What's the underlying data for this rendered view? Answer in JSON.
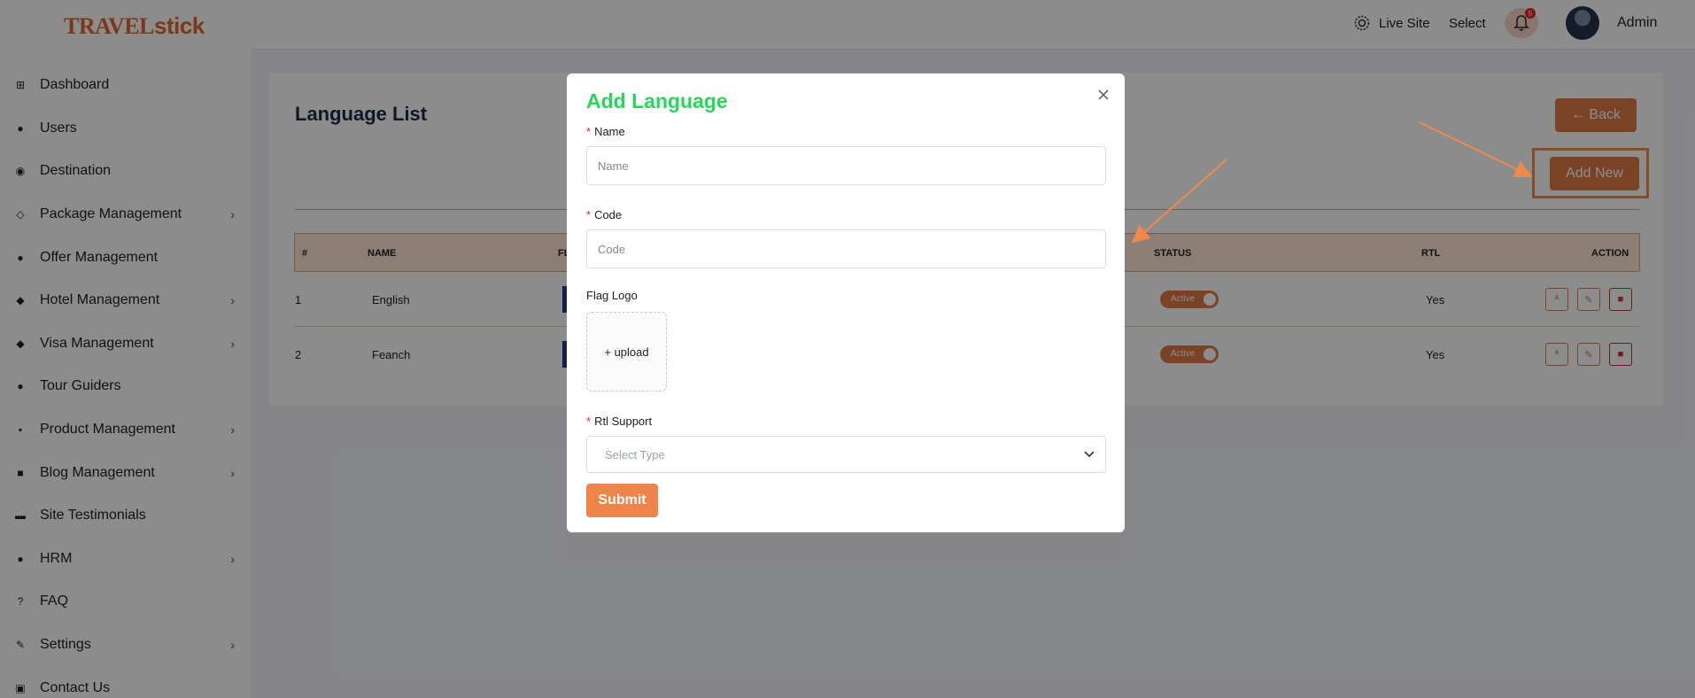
{
  "brand": {
    "logo_part1": "TRAVEL",
    "logo_part2": "stick",
    "color": "#e0692c"
  },
  "sidebar": {
    "items": [
      {
        "label": "Dashboard",
        "icon": "grid-icon",
        "has_submenu": false
      },
      {
        "label": "Users",
        "icon": "users-icon",
        "has_submenu": false
      },
      {
        "label": "Destination",
        "icon": "location-icon",
        "has_submenu": false
      },
      {
        "label": "Package Management",
        "icon": "box-icon",
        "has_submenu": true
      },
      {
        "label": "Offer Management",
        "icon": "offer-icon",
        "has_submenu": false
      },
      {
        "label": "Hotel Management",
        "icon": "hotel-icon",
        "has_submenu": true
      },
      {
        "label": "Visa Management",
        "icon": "visa-icon",
        "has_submenu": true
      },
      {
        "label": "Tour Guiders",
        "icon": "person-icon",
        "has_submenu": false
      },
      {
        "label": "Product Management",
        "icon": "apps-icon",
        "has_submenu": true
      },
      {
        "label": "Blog Management",
        "icon": "blog-icon",
        "has_submenu": true
      },
      {
        "label": "Site Testimonials",
        "icon": "chat-icon",
        "has_submenu": false
      },
      {
        "label": "HRM",
        "icon": "team-icon",
        "has_submenu": true
      },
      {
        "label": "FAQ",
        "icon": "question-icon",
        "has_submenu": false
      },
      {
        "label": "Settings",
        "icon": "wrench-icon",
        "has_submenu": true
      },
      {
        "label": "Contact Us",
        "icon": "contact-icon",
        "has_submenu": false
      }
    ]
  },
  "topbar": {
    "live_site": "Live Site",
    "select": "Select",
    "notification_count": "5",
    "user": "Admin"
  },
  "page": {
    "title": "Language List",
    "back_label": "← Back",
    "add_new_label": "Add New"
  },
  "table": {
    "headers": {
      "num": "#",
      "name": "NAME",
      "flag": "FL",
      "status": "STATUS",
      "rtl": "RTL",
      "action": "ACTION"
    },
    "rows": [
      {
        "num": "1",
        "name": "English",
        "status": "Active",
        "rtl": "Yes"
      },
      {
        "num": "2",
        "name": "Feanch",
        "status": "Active",
        "rtl": "Yes"
      }
    ]
  },
  "modal": {
    "title": "Add Language",
    "name_label": "Name",
    "name_placeholder": "Name",
    "code_label": "Code",
    "code_placeholder": "Code",
    "flag_label": "Flag Logo",
    "upload_label": "+ upload",
    "rtl_label": "Rtl Support",
    "rtl_placeholder": "Select Type",
    "submit_label": "Submit",
    "title_color": "#27d65b"
  },
  "colors": {
    "accent": "#e07a45",
    "annotation": "#f08a4b",
    "required": "#e02929"
  }
}
